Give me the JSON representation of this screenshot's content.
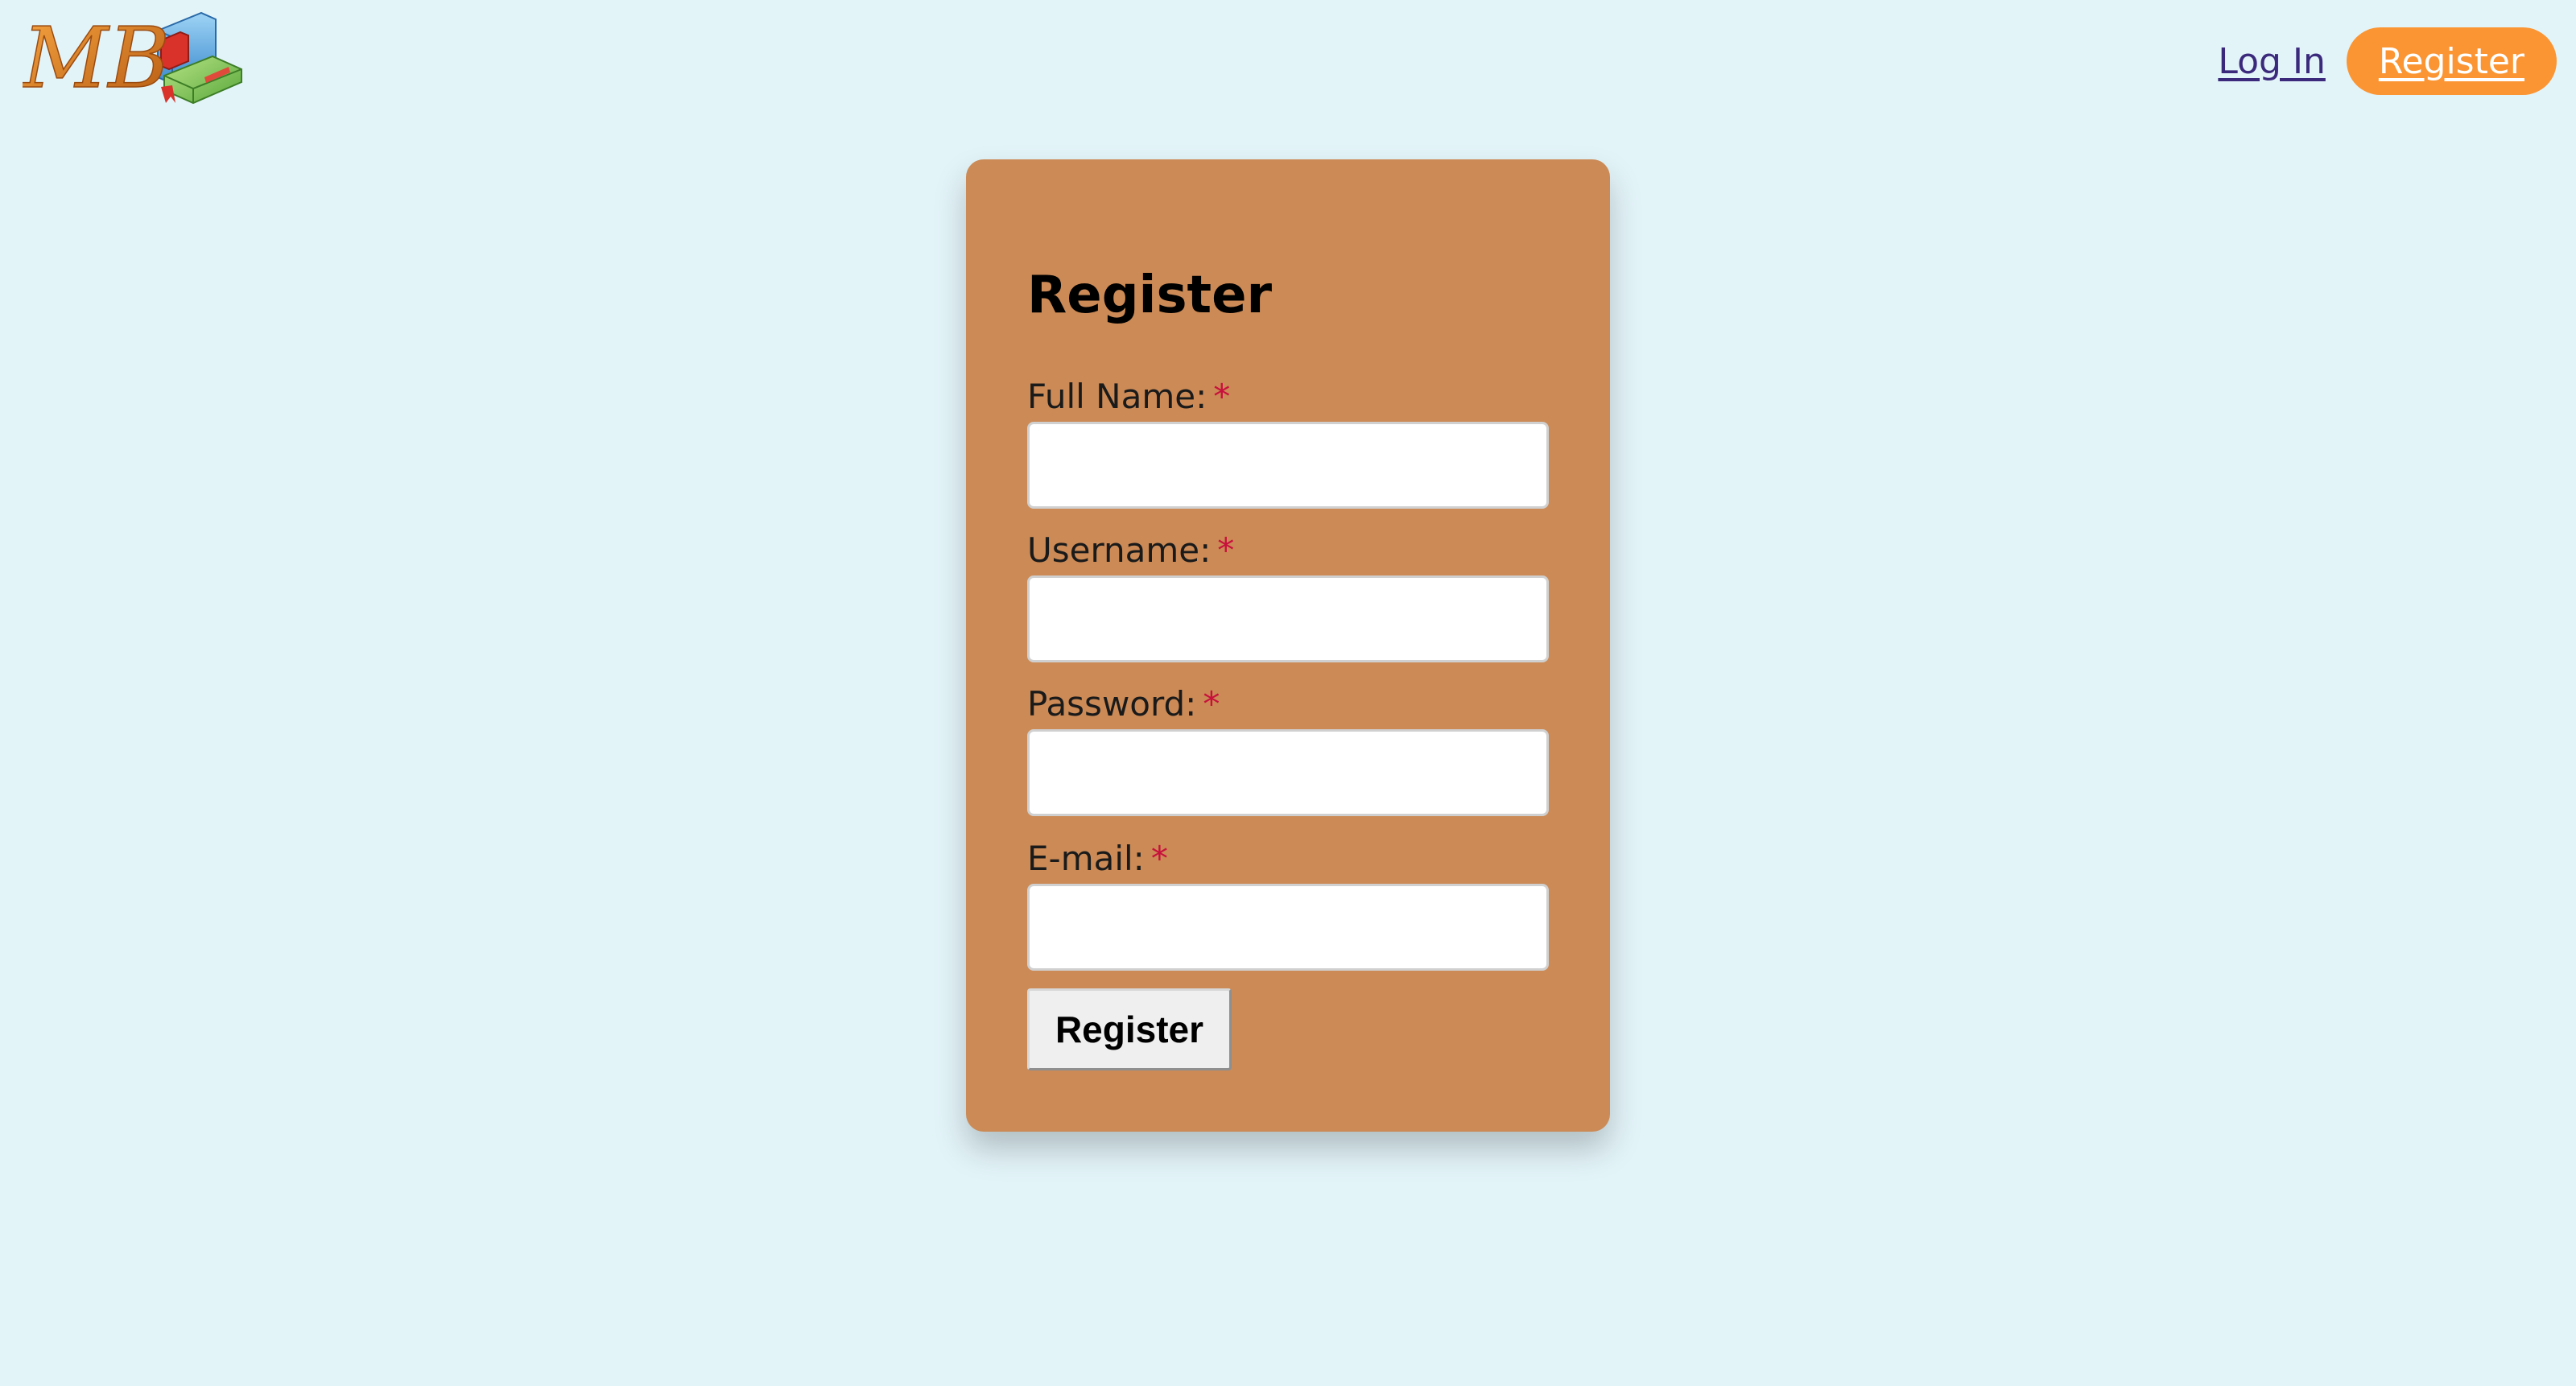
{
  "header": {
    "logo_icon": "mb-books-logo-icon",
    "logo_text": "MB",
    "nav": {
      "login_label": "Log In",
      "register_label": "Register"
    }
  },
  "form": {
    "title": "Register",
    "required_marker": "*",
    "fields": [
      {
        "label": "Full Name:",
        "value": "",
        "placeholder": ""
      },
      {
        "label": "Username:",
        "value": "",
        "placeholder": ""
      },
      {
        "label": "Password:",
        "value": "",
        "placeholder": ""
      },
      {
        "label": "E-mail:",
        "value": "",
        "placeholder": ""
      }
    ],
    "submit_label": "Register"
  },
  "colors": {
    "background": "#e3f4f9",
    "card": "#cb8a56",
    "accent": "#fb9533",
    "required": "#c8103c",
    "link": "#3b2a7c"
  }
}
